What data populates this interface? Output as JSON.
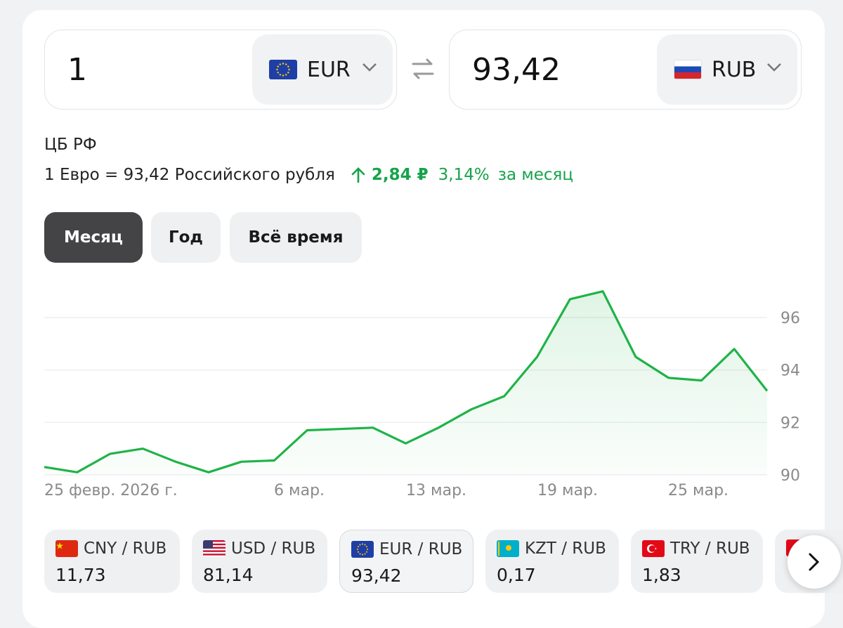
{
  "converter": {
    "from": {
      "amount": "1",
      "currency": "EUR",
      "flag": "eu-flag-icon"
    },
    "to": {
      "amount": "93,42",
      "currency": "RUB",
      "flag": "ru-flag-icon"
    }
  },
  "source": "ЦБ РФ",
  "rate": {
    "text": "1 Евро = 93,42 Российского рубля",
    "change_abs": "2,84 ₽",
    "change_pct": "3,14%",
    "period": "за месяц",
    "color": "#16a34a"
  },
  "periods": [
    {
      "label": "Месяц",
      "active": true
    },
    {
      "label": "Год",
      "active": false
    },
    {
      "label": "Всё время",
      "active": false
    }
  ],
  "chart_data": {
    "type": "area",
    "x": [
      "25 февр.",
      "26 февр.",
      "27 февр.",
      "28 февр.",
      "1 мар.",
      "2 мар.",
      "5 мар.",
      "6 мар.",
      "7 мар.",
      "10 мар.",
      "12 мар.",
      "13 мар.",
      "14 мар.",
      "15 мар.",
      "17 мар.",
      "18 мар.",
      "19 мар.",
      "20 мар.",
      "21 мар.",
      "22 мар.",
      "24 мар.",
      "25 мар.",
      "26 мар."
    ],
    "y": [
      90.3,
      90.1,
      90.8,
      91.0,
      90.5,
      90.1,
      90.5,
      90.55,
      91.7,
      91.75,
      91.8,
      91.2,
      91.8,
      92.5,
      93.0,
      94.5,
      96.7,
      97.0,
      94.5,
      93.7,
      93.6,
      94.8,
      93.2
    ],
    "x_ticks": [
      "25 февр. 2026 г.",
      "6 мар.",
      "13 мар.",
      "19 мар.",
      "25 мар."
    ],
    "y_ticks": [
      "90",
      "92",
      "94",
      "96"
    ],
    "ylim": [
      89.8,
      97.5
    ],
    "grid": true,
    "line_color": "#1fb347"
  },
  "pairs": [
    {
      "label": "CNY / RUB",
      "value": "11,73",
      "flag": "cn-flag-icon",
      "active": false
    },
    {
      "label": "USD / RUB",
      "value": "81,14",
      "flag": "us-flag-icon",
      "active": false
    },
    {
      "label": "EUR / RUB",
      "value": "93,42",
      "flag": "eu-flag-icon",
      "active": true
    },
    {
      "label": "KZT / RUB",
      "value": "0,17",
      "flag": "kz-flag-icon",
      "active": false
    },
    {
      "label": "TRY / RUB",
      "value": "1,83",
      "flag": "tr-flag-icon",
      "active": false
    }
  ]
}
